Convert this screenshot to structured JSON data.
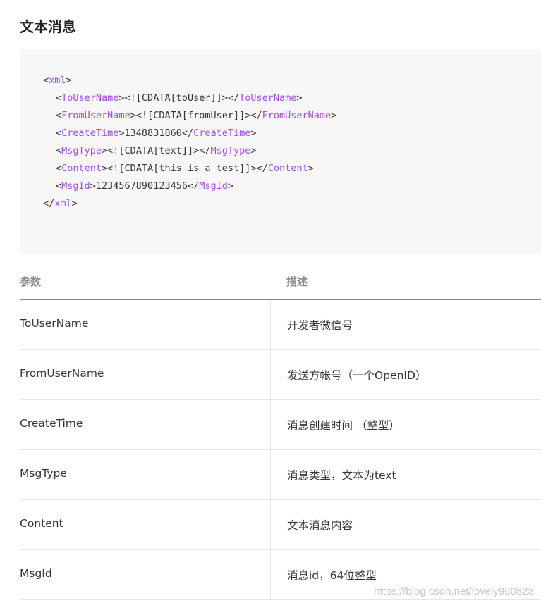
{
  "section_title": "文本消息",
  "code": {
    "lines": [
      {
        "indent": 0,
        "parts": [
          {
            "t": "<",
            "k": "plain"
          },
          {
            "t": "xml",
            "k": "tag"
          },
          {
            "t": ">",
            "k": "plain"
          }
        ]
      },
      {
        "indent": 1,
        "parts": [
          {
            "t": "<",
            "k": "plain"
          },
          {
            "t": "ToUserName",
            "k": "tag"
          },
          {
            "t": "><![CDATA[toUser]]></",
            "k": "plain"
          },
          {
            "t": "ToUserName",
            "k": "tag"
          },
          {
            "t": ">",
            "k": "plain"
          }
        ]
      },
      {
        "indent": 1,
        "parts": [
          {
            "t": "<",
            "k": "plain"
          },
          {
            "t": "FromUserName",
            "k": "tag"
          },
          {
            "t": "><![CDATA[fromUser]]></",
            "k": "plain"
          },
          {
            "t": "FromUserName",
            "k": "tag"
          },
          {
            "t": ">",
            "k": "plain"
          }
        ]
      },
      {
        "indent": 1,
        "parts": [
          {
            "t": "<",
            "k": "plain"
          },
          {
            "t": "CreateTime",
            "k": "tag"
          },
          {
            "t": ">1348831860</",
            "k": "plain"
          },
          {
            "t": "CreateTime",
            "k": "tag"
          },
          {
            "t": ">",
            "k": "plain"
          }
        ]
      },
      {
        "indent": 1,
        "parts": [
          {
            "t": "<",
            "k": "plain"
          },
          {
            "t": "MsgType",
            "k": "tag"
          },
          {
            "t": "><![CDATA[text]]></",
            "k": "plain"
          },
          {
            "t": "MsgType",
            "k": "tag"
          },
          {
            "t": ">",
            "k": "plain"
          }
        ]
      },
      {
        "indent": 1,
        "parts": [
          {
            "t": "<",
            "k": "plain"
          },
          {
            "t": "Content",
            "k": "tag"
          },
          {
            "t": "><![CDATA[this is a test]]></",
            "k": "plain"
          },
          {
            "t": "Content",
            "k": "tag"
          },
          {
            "t": ">",
            "k": "plain"
          }
        ]
      },
      {
        "indent": 1,
        "parts": [
          {
            "t": "<",
            "k": "plain"
          },
          {
            "t": "MsgId",
            "k": "tag"
          },
          {
            "t": ">1234567890123456</",
            "k": "plain"
          },
          {
            "t": "MsgId",
            "k": "tag"
          },
          {
            "t": ">",
            "k": "plain"
          }
        ]
      },
      {
        "indent": 0,
        "parts": [
          {
            "t": "</",
            "k": "plain"
          },
          {
            "t": "xml",
            "k": "tag"
          },
          {
            "t": ">",
            "k": "plain"
          }
        ]
      }
    ]
  },
  "table": {
    "headers": {
      "param": "参数",
      "desc": "描述"
    },
    "rows": [
      {
        "param": "ToUserName",
        "desc": "开发者微信号"
      },
      {
        "param": "FromUserName",
        "desc": "发送方帐号（一个OpenID）"
      },
      {
        "param": "CreateTime",
        "desc": "消息创建时间 （整型）"
      },
      {
        "param": "MsgType",
        "desc": "消息类型，文本为text"
      },
      {
        "param": "Content",
        "desc": "文本消息内容"
      },
      {
        "param": "MsgId",
        "desc": "消息id，64位整型"
      }
    ]
  },
  "watermark": "https://blog.csdn.net/lovely960823",
  "colors": {
    "tag": "#a64ee0",
    "code_bg": "#f7f7f7",
    "text": "#353535",
    "header_text": "#8a8a8a"
  }
}
